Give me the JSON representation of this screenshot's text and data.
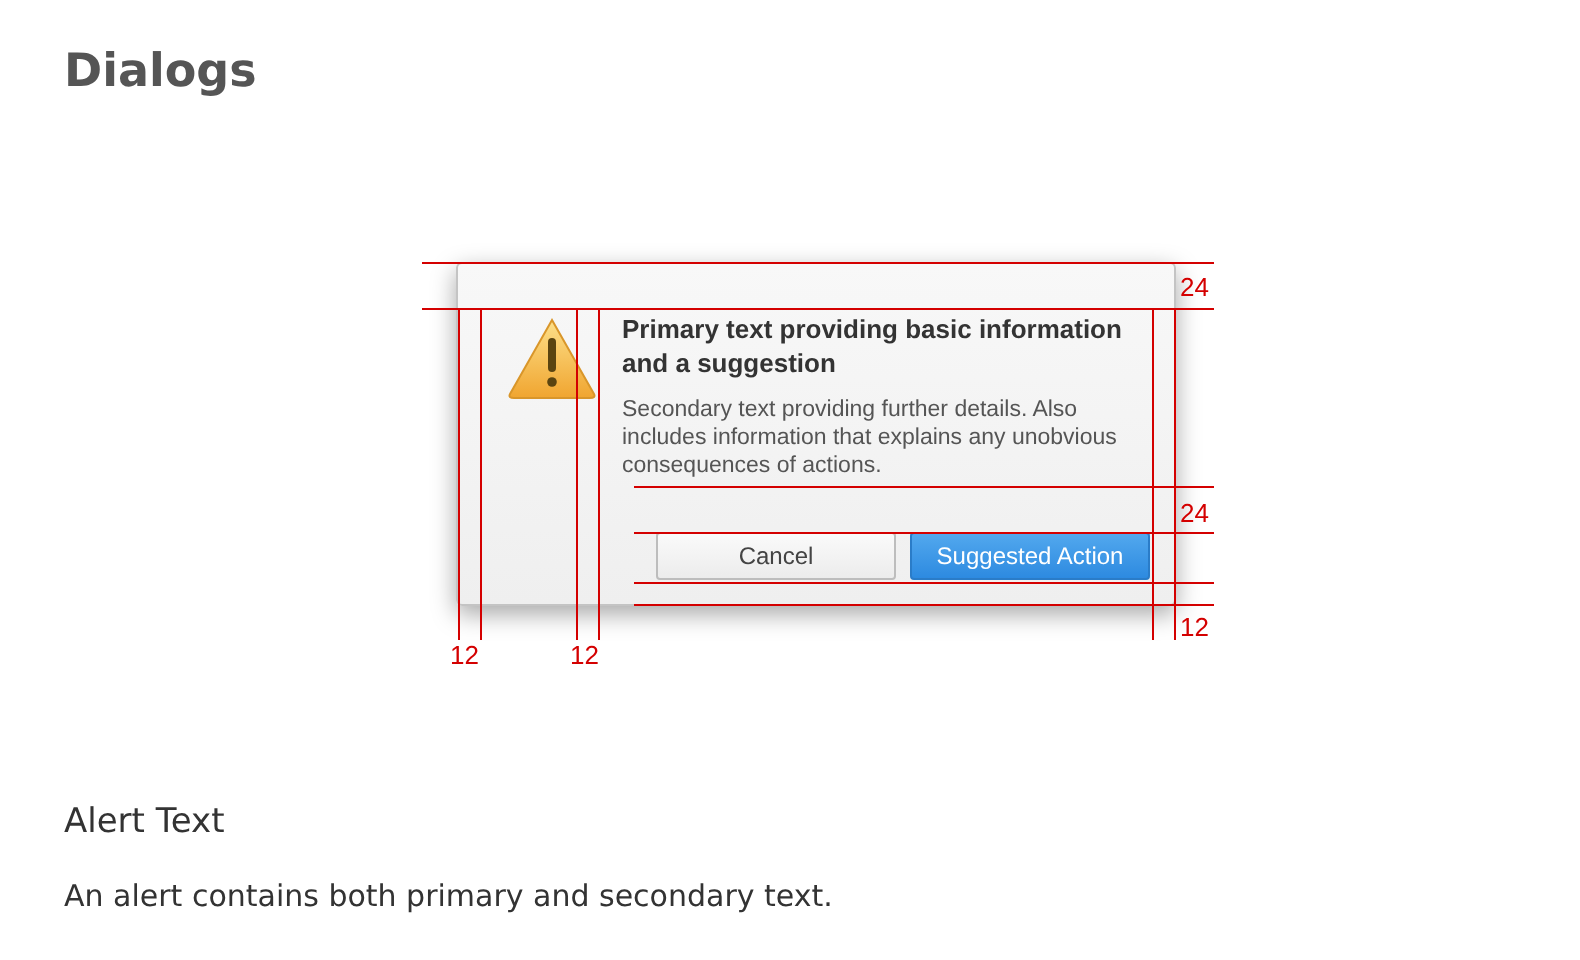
{
  "page_title": "Dialogs",
  "dialog": {
    "primary_text": "Primary text providing basic information and a suggestion",
    "secondary_text": "Secondary text providing further details. Also includes information that explains any unobvious consequences of actions.",
    "buttons": [
      {
        "label": "Cancel",
        "kind": "normal"
      },
      {
        "label": "Suggested Action",
        "kind": "suggested"
      }
    ]
  },
  "measurements": [
    "24",
    "24",
    "12",
    "12",
    "12"
  ],
  "section_title": "Alert Text",
  "section_text": "An alert contains both primary and secondary text."
}
